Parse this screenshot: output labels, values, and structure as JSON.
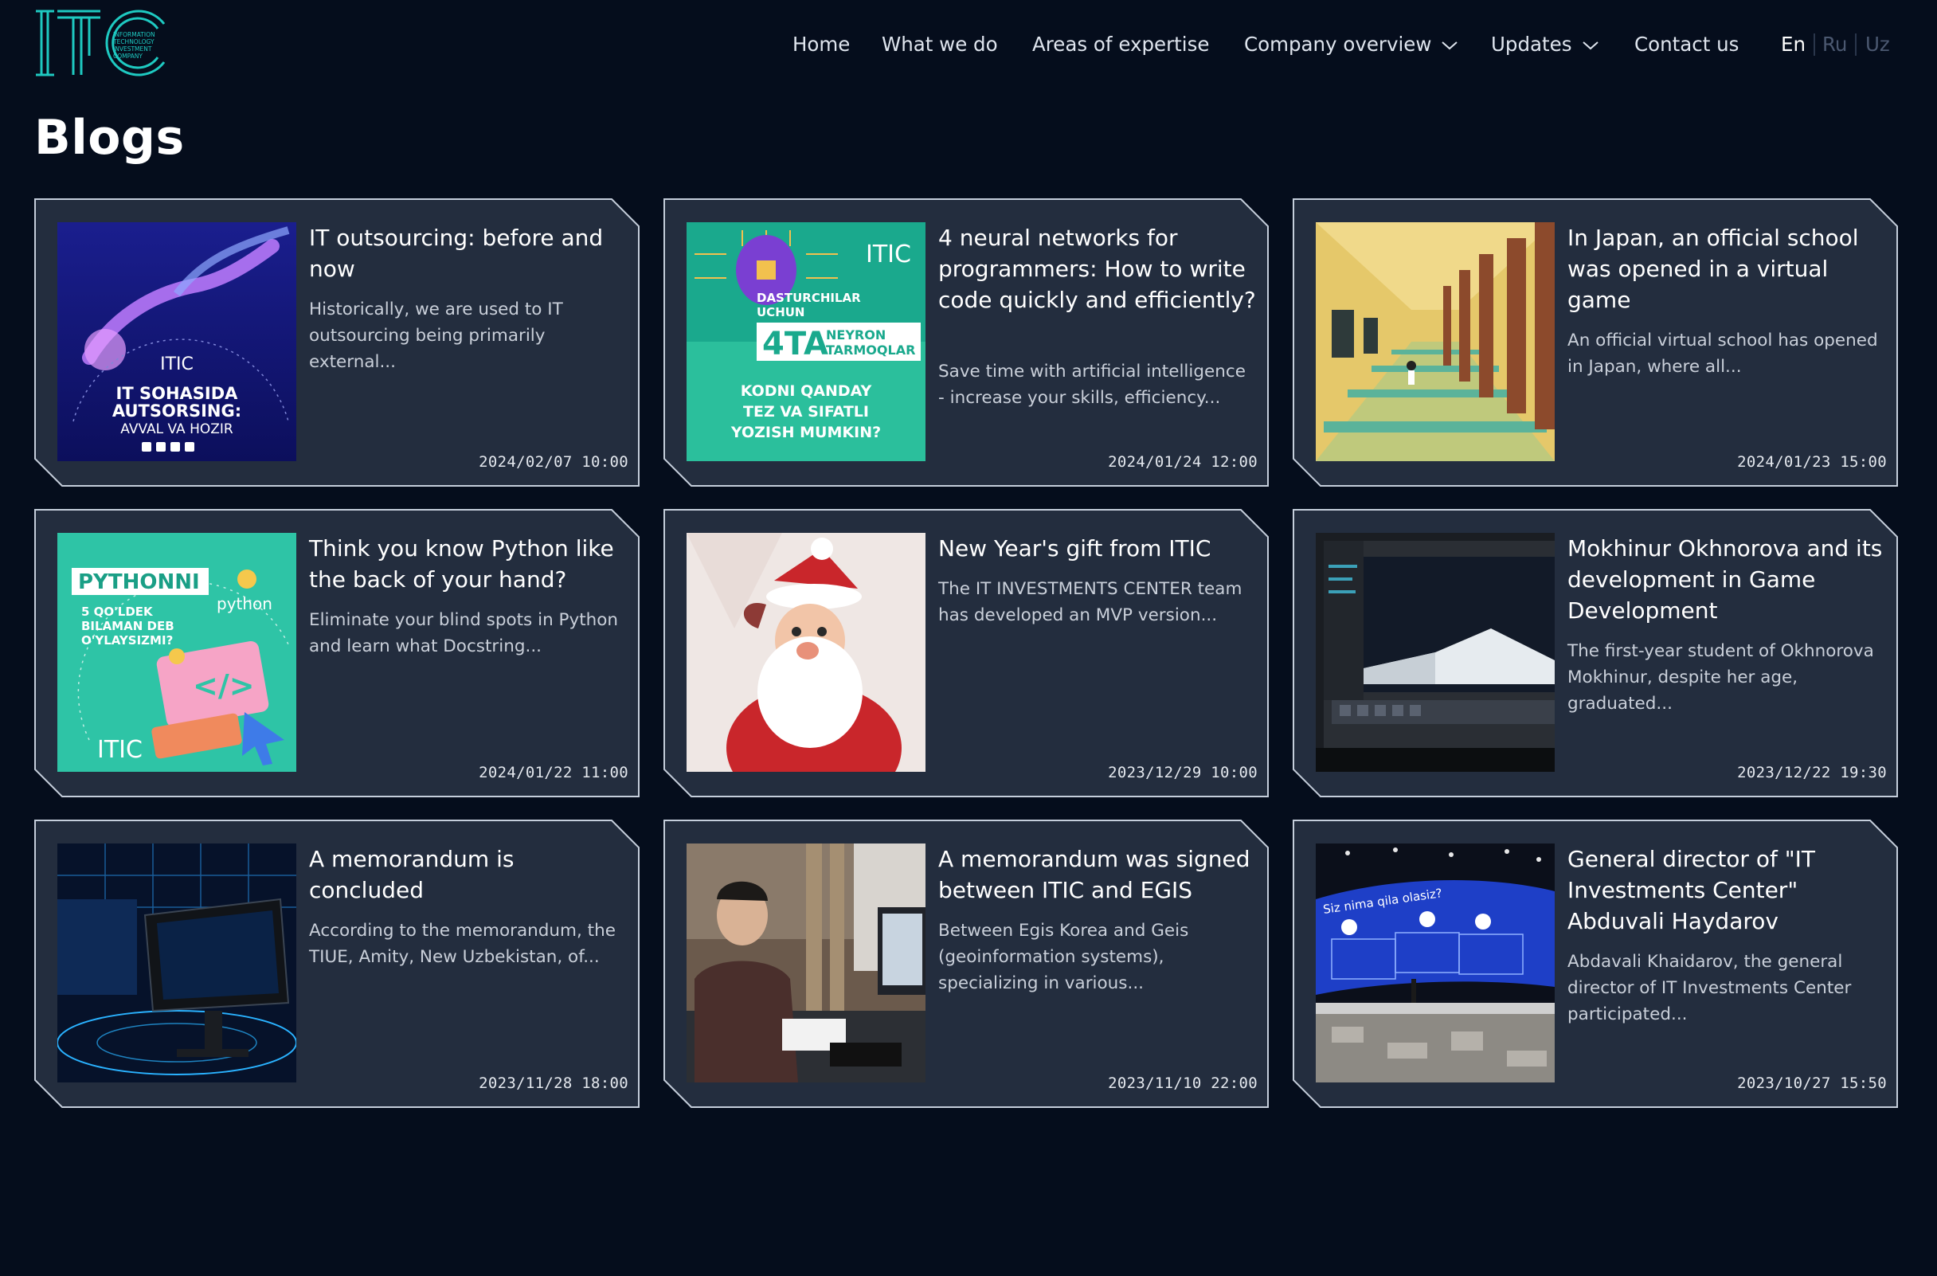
{
  "logo": {
    "text": "ITIC",
    "tagline": [
      "INFORMATION",
      "TECHNOLOGY",
      "INVESTMENT",
      "COMPANY"
    ]
  },
  "nav": {
    "items": [
      "Home",
      "What we do",
      "Areas of expertise",
      "Company overview",
      "Updates",
      "Contact us"
    ],
    "languages": [
      "En",
      "Ru",
      "Uz"
    ],
    "active_language": "En"
  },
  "page_title": "Blogs",
  "colors": {
    "background": "#050d1c",
    "card": "#232d3e",
    "accent": "#1ec9c1",
    "text_dim": "#4b5870"
  },
  "posts": [
    {
      "title": "IT outsourcing: before and now",
      "excerpt": "Historically, we are used to IT outsourcing being primarily external...",
      "date": "2024/02/07  10:00",
      "image_text": [
        "IT SOHASIDA",
        "AUTSORSING:",
        "AVVAL VA HOZIR"
      ]
    },
    {
      "title": "4 neural networks for programmers: How to write code quickly and efficiently?",
      "excerpt": "Save time with artificial intelligence - increase your skills, efficiency...",
      "date": "2024/01/24  12:00",
      "image_text": [
        "DASTURCHILAR",
        "UCHUN",
        "4TA",
        "NEYRON",
        "TARMOQLAR",
        "KODNI QANDAY",
        "TEZ VA SIFATLI",
        "YOZISH MUMKIN?"
      ]
    },
    {
      "title": "In Japan, an official school was opened in a virtual game",
      "excerpt": "An official virtual school has opened in Japan, where all...",
      "date": "2024/01/23  15:00"
    },
    {
      "title": "Think you know Python like the back of your hand?",
      "excerpt": "Eliminate your blind spots in Python and learn what Docstring...",
      "date": "2024/01/22  11:00",
      "image_text": [
        "PYTHONNI",
        "5 QO'LDEK",
        "BILAMAN DEB",
        "O'YLAYSIZMI?",
        "python"
      ]
    },
    {
      "title": "New Year's gift from ITIC",
      "excerpt": "The IT INVESTMENTS CENTER team has developed an MVP version...",
      "date": "2023/12/29  10:00"
    },
    {
      "title": "Mokhinur Okhnorova and its development in Game Development",
      "excerpt": "The first-year student of Okhnorova Mokhinur, despite her age, graduated...",
      "date": "2023/12/22  19:30"
    },
    {
      "title": "A memorandum is concluded",
      "excerpt": "According to the memorandum, the TIUE, Amity, New Uzbekistan, of...",
      "date": "2023/11/28  18:00"
    },
    {
      "title": "A memorandum was signed between ITIC and EGIS",
      "excerpt": "Between Egis Korea and Geis (geoinformation systems), specializing in various...",
      "date": "2023/11/10  22:00"
    },
    {
      "title": "General director of \"IT Investments Center\" Abduvali Haydarov",
      "excerpt": "Abdavali Khaidarov, the general director of IT Investments Center participated...",
      "date": "2023/10/27  15:50",
      "image_text": [
        "Siz nima qila olasiz?"
      ]
    }
  ]
}
